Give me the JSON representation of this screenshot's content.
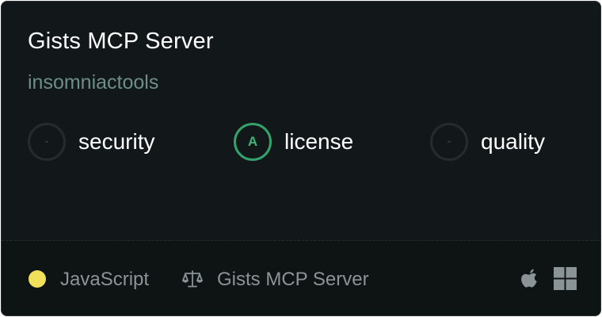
{
  "card": {
    "title": "Gists MCP Server",
    "author": "insomniactools"
  },
  "scores": [
    {
      "label": "security",
      "grade": "-",
      "status": "none"
    },
    {
      "label": "license",
      "grade": "A",
      "status": "good"
    },
    {
      "label": "quality",
      "grade": "-",
      "status": "none"
    }
  ],
  "footer": {
    "language": "JavaScript",
    "language_color": "#f1e05a",
    "license_name": "Gists MCP Server",
    "license_icon": "scale-icon",
    "platforms": [
      "apple-icon",
      "windows-icon"
    ]
  },
  "colors": {
    "background": "#121819",
    "grade_good": "#34a36b",
    "author": "#6d8f85"
  }
}
